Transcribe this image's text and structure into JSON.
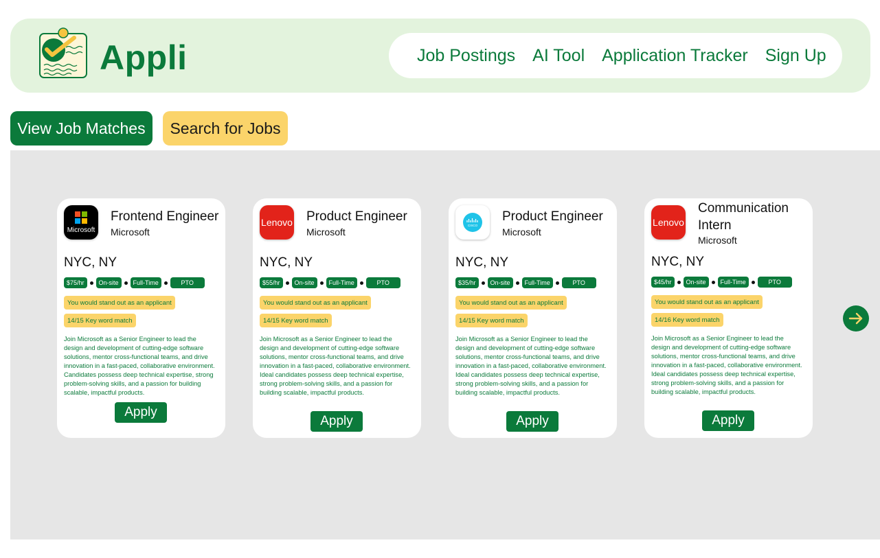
{
  "brand": {
    "name": "Appli",
    "accent": "#0b7a3b",
    "header_bg": "#e3f3dd",
    "highlight": "#fbd46a"
  },
  "nav": {
    "items": [
      "Job Postings",
      "AI Tool",
      "Application Tracker",
      "Sign Up"
    ]
  },
  "tabs": {
    "matches": "View Job Matches",
    "search": "Search for Jobs"
  },
  "cards": [
    {
      "title": "Frontend Engineer",
      "company": "Microsoft",
      "logo": "microsoft-logo",
      "location": "NYC, NY",
      "tags": [
        "$75/hr",
        "On-site",
        "Full-Time",
        "PTO"
      ],
      "standout": "You would stand out as an applicant",
      "keywords": "14/15 Key word match",
      "description": "Join Microsoft as a Senior Engineer to lead the design and development of cutting-edge software solutions, mentor cross-functional teams, and drive innovation in a fast-paced, collaborative environment. Candidates possess deep technical expertise, strong problem-solving skills, and a passion for building scalable, impactful products.",
      "apply": "Apply"
    },
    {
      "title": "Product Engineer",
      "company": "Microsoft",
      "logo": "lenovo-logo",
      "location": "NYC, NY",
      "tags": [
        "$55/hr",
        "On-site",
        "Full-Time",
        "PTO"
      ],
      "standout": "You would stand out as an applicant",
      "keywords": "14/15 Key word match",
      "description": "Join Microsoft as a Senior Engineer to lead the design and development of cutting-edge software solutions, mentor cross-functional teams, and drive innovation in a fast-paced, collaborative environment. Ideal candidates possess deep technical expertise, strong problem-solving skills, and a passion for building scalable, impactful products.",
      "apply": "Apply"
    },
    {
      "title": "Product Engineer",
      "company": "Microsoft",
      "logo": "cisco-logo",
      "location": "NYC, NY",
      "tags": [
        "$35/hr",
        "On-site",
        "Full-Time",
        "PTO"
      ],
      "standout": "You would stand out as an applicant",
      "keywords": "14/15 Key word match",
      "description": "Join Microsoft as a Senior Engineer to lead the design and development of cutting-edge software solutions, mentor cross-functional teams, and drive innovation in a fast-paced, collaborative environment. Ideal candidates possess deep technical expertise, strong problem-solving skills, and a passion for building scalable, impactful products.",
      "apply": "Apply"
    },
    {
      "title": "Communication Intern",
      "company": "Microsoft",
      "logo": "lenovo-logo",
      "location": "NYC, NY",
      "tags": [
        "$45/hr",
        "On-site",
        "Full-Time",
        "PTO"
      ],
      "standout": "You would stand out as an applicant",
      "keywords": "14/16 Key word match",
      "description": "Join Microsoft as a Senior Engineer to lead the design and development of cutting-edge software solutions, mentor cross-functional teams, and drive innovation in a fast-paced, collaborative environment. Ideal candidates possess deep technical expertise, strong problem-solving skills, and a passion for building scalable, impactful products.",
      "apply": "Apply"
    }
  ],
  "logo_text": {
    "microsoft": "Microsoft",
    "lenovo": "Lenovo",
    "cisco": "CISCO"
  },
  "carousel": {
    "next_icon": "arrow-right-icon"
  }
}
